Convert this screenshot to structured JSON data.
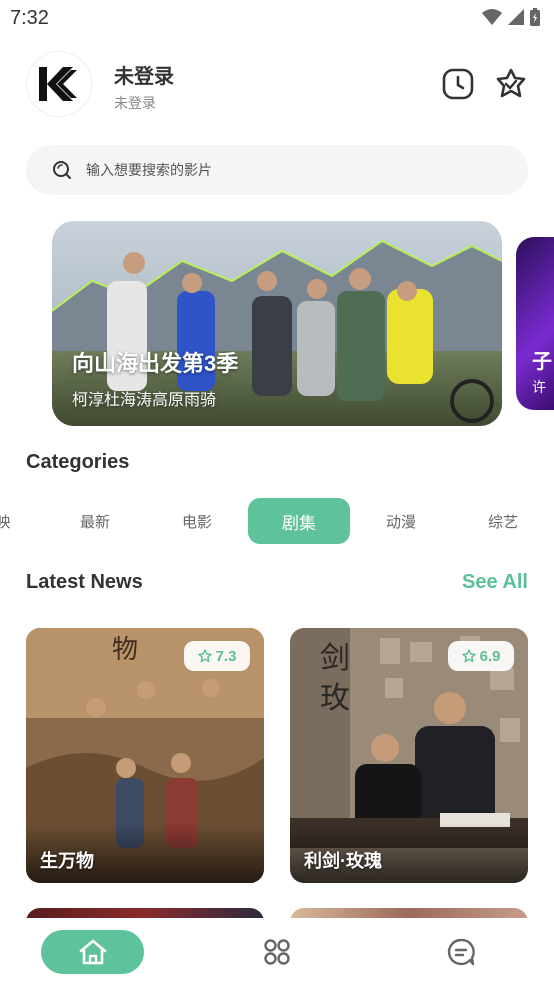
{
  "status_bar": {
    "time": "7:32"
  },
  "header": {
    "logo": "K",
    "user_name": "未登录",
    "user_sub": "未登录"
  },
  "search": {
    "placeholder": "输入想要搜索的影片"
  },
  "banners": [
    {
      "title": "向山海出发第3季",
      "subtitle": "柯淳杜海涛高原雨骑"
    },
    {
      "title": "子",
      "subtitle": "许"
    }
  ],
  "categories": {
    "title": "Categories",
    "items": [
      "映",
      "最新",
      "电影",
      "剧集",
      "动漫",
      "综艺"
    ],
    "active": "剧集"
  },
  "latest": {
    "title": "Latest News",
    "see_all": "See All",
    "cards": [
      {
        "title": "生万物",
        "rating": "7.3"
      },
      {
        "title": "利剑·玫瑰",
        "rating": "6.9"
      }
    ]
  },
  "colors": {
    "accent": "#5ec39b",
    "text": "#333333"
  },
  "icons": [
    "history-icon",
    "favorite-icon",
    "search-icon",
    "star-icon",
    "home-icon",
    "category-icon",
    "message-icon"
  ]
}
